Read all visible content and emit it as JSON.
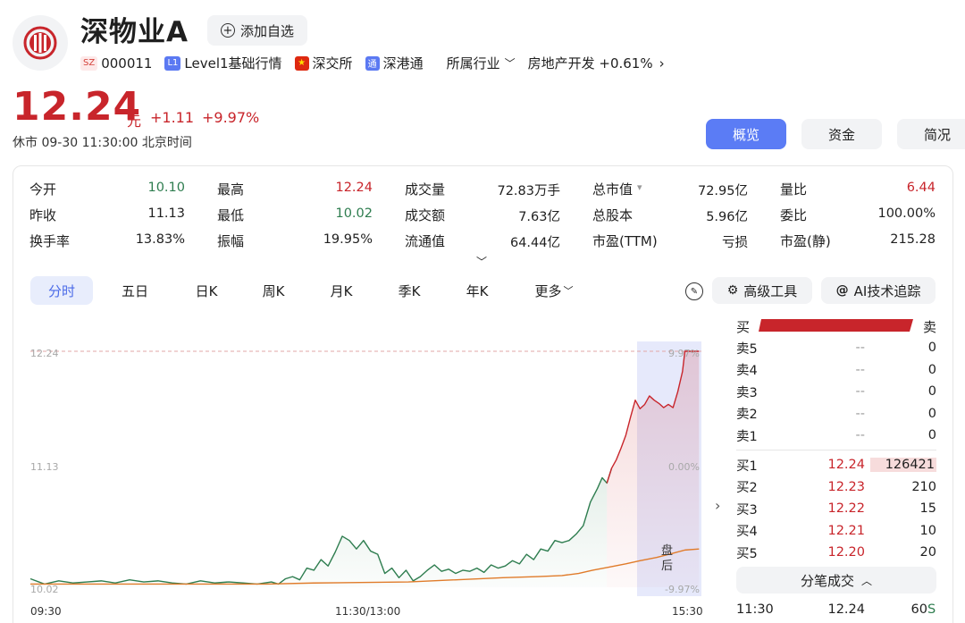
{
  "header": {
    "name": "深物业A",
    "add_favorite": "添加自选",
    "market_tag": "SZ",
    "code": "000011",
    "level_tag": "L1",
    "level_label": "Level1基础行情",
    "exchange": "深交所",
    "connect_tag": "通",
    "connect": "深港通",
    "industry_dropdown": "所属行业",
    "industry": "房地产开发 +0.61%"
  },
  "quote": {
    "price": "12.24",
    "unit": "元",
    "change": "+1.11",
    "change_pct": "+9.97%",
    "status": "休市  09-30 11:30:00 北京时间"
  },
  "top_tabs": [
    "概览",
    "资金",
    "简况"
  ],
  "stats": [
    [
      {
        "label": "今开",
        "value": "10.10",
        "color": "green"
      },
      {
        "label": "最高",
        "value": "12.24",
        "color": "red"
      },
      {
        "label": "成交量",
        "value": "72.83万手",
        "color": ""
      },
      {
        "label": "总市值",
        "value": "72.95亿",
        "color": "",
        "dropdown": "▾"
      },
      {
        "label": "量比",
        "value": "6.44",
        "color": "red"
      }
    ],
    [
      {
        "label": "昨收",
        "value": "11.13",
        "color": ""
      },
      {
        "label": "最低",
        "value": "10.02",
        "color": "green"
      },
      {
        "label": "成交额",
        "value": "7.63亿",
        "color": ""
      },
      {
        "label": "总股本",
        "value": "5.96亿",
        "color": ""
      },
      {
        "label": "委比",
        "value": "100.00%",
        "color": ""
      }
    ],
    [
      {
        "label": "换手率",
        "value": "13.83%",
        "color": ""
      },
      {
        "label": "振幅",
        "value": "19.95%",
        "color": ""
      },
      {
        "label": "流通值",
        "value": "64.44亿",
        "color": ""
      },
      {
        "label": "市盈(TTM)",
        "value": "亏损",
        "color": ""
      },
      {
        "label": "市盈(静)",
        "value": "215.28",
        "color": ""
      }
    ]
  ],
  "chart_tabs": [
    "分时",
    "五日",
    "日K",
    "周K",
    "月K",
    "季K",
    "年K",
    "更多"
  ],
  "tools": {
    "advanced": "高级工具",
    "ai": "AI技术追踪"
  },
  "colors": {
    "up": "#c8252b",
    "down": "#2e7d4f",
    "accent": "#5b7cf5",
    "avg_line": "#e07b2a"
  },
  "chart_data": {
    "type": "line",
    "title": "",
    "y_labels": [
      "12.24",
      "11.13",
      "10.02"
    ],
    "pct_labels": [
      "9.97%",
      "0.00%",
      "-9.97%"
    ],
    "x_labels": [
      "09:30",
      "11:30/13:00",
      "15:30"
    ],
    "after_hours_label": "盘后",
    "ylim": [
      10.02,
      12.24
    ],
    "prev_close": 11.13,
    "series": [
      {
        "name": "",
        "points": [
          [
            0,
            10.1
          ],
          [
            6,
            10.05
          ],
          [
            12,
            10.08
          ],
          [
            18,
            10.06
          ],
          [
            24,
            10.07
          ],
          [
            30,
            10.08
          ],
          [
            36,
            10.06
          ],
          [
            42,
            10.09
          ],
          [
            48,
            10.07
          ],
          [
            54,
            10.08
          ],
          [
            60,
            10.06
          ],
          [
            66,
            10.05
          ],
          [
            72,
            10.08
          ],
          [
            78,
            10.06
          ],
          [
            84,
            10.07
          ],
          [
            90,
            10.06
          ],
          [
            96,
            10.05
          ],
          [
            102,
            10.07
          ],
          [
            105,
            10.05
          ],
          [
            108,
            10.1
          ],
          [
            111,
            10.12
          ],
          [
            114,
            10.09
          ],
          [
            117,
            10.2
          ],
          [
            120,
            10.18
          ],
          [
            123,
            10.28
          ],
          [
            126,
            10.22
          ],
          [
            129,
            10.35
          ],
          [
            132,
            10.5
          ],
          [
            135,
            10.46
          ],
          [
            138,
            10.38
          ],
          [
            141,
            10.46
          ],
          [
            144,
            10.36
          ],
          [
            147,
            10.33
          ],
          [
            150,
            10.15
          ],
          [
            153,
            10.2
          ],
          [
            156,
            10.11
          ],
          [
            159,
            10.18
          ],
          [
            162,
            10.08
          ],
          [
            165,
            10.12
          ],
          [
            168,
            10.18
          ],
          [
            171,
            10.23
          ],
          [
            174,
            10.17
          ],
          [
            177,
            10.19
          ],
          [
            180,
            10.15
          ],
          [
            183,
            10.18
          ],
          [
            186,
            10.17
          ],
          [
            189,
            10.2
          ],
          [
            192,
            10.16
          ],
          [
            195,
            10.23
          ],
          [
            198,
            10.2
          ],
          [
            201,
            10.22
          ],
          [
            204,
            10.27
          ],
          [
            207,
            10.24
          ],
          [
            210,
            10.33
          ],
          [
            213,
            10.28
          ],
          [
            216,
            10.38
          ],
          [
            219,
            10.36
          ],
          [
            222,
            10.46
          ],
          [
            225,
            10.44
          ],
          [
            228,
            10.46
          ],
          [
            231,
            10.52
          ],
          [
            234,
            10.6
          ],
          [
            237,
            10.82
          ],
          [
            240,
            10.95
          ],
          [
            242,
            11.05
          ],
          [
            244,
            11.0
          ],
          [
            246,
            11.14
          ],
          [
            248,
            11.22
          ],
          [
            250,
            11.33
          ],
          [
            252,
            11.45
          ],
          [
            254,
            11.62
          ],
          [
            256,
            11.78
          ],
          [
            258,
            11.7
          ],
          [
            260,
            11.74
          ],
          [
            262,
            11.82
          ],
          [
            264,
            11.78
          ],
          [
            266,
            11.75
          ],
          [
            268,
            11.71
          ],
          [
            270,
            11.74
          ],
          [
            272,
            11.71
          ],
          [
            274,
            11.86
          ],
          [
            276,
            12.05
          ],
          [
            277,
            12.24
          ],
          [
            280,
            12.24
          ],
          [
            283,
            12.24
          ]
        ]
      },
      {
        "name": "",
        "points": [
          [
            0,
            10.05
          ],
          [
            60,
            10.05
          ],
          [
            100,
            10.05
          ],
          [
            120,
            10.06
          ],
          [
            160,
            10.07
          ],
          [
            200,
            10.11
          ],
          [
            215,
            10.12
          ],
          [
            225,
            10.13
          ],
          [
            232,
            10.15
          ],
          [
            238,
            10.18
          ],
          [
            245,
            10.21
          ],
          [
            252,
            10.24
          ],
          [
            258,
            10.27
          ],
          [
            265,
            10.3
          ],
          [
            272,
            10.34
          ],
          [
            277,
            10.37
          ],
          [
            283,
            10.38
          ]
        ]
      }
    ],
    "grid": false
  },
  "order_book": {
    "buy_label": "买",
    "sell_label": "卖",
    "sells": [
      {
        "label": "卖5",
        "price": "--",
        "volume": "0"
      },
      {
        "label": "卖4",
        "price": "--",
        "volume": "0"
      },
      {
        "label": "卖3",
        "price": "--",
        "volume": "0"
      },
      {
        "label": "卖2",
        "price": "--",
        "volume": "0"
      },
      {
        "label": "卖1",
        "price": "--",
        "volume": "0"
      }
    ],
    "buys": [
      {
        "label": "买1",
        "price": "12.24",
        "volume": "126421"
      },
      {
        "label": "买2",
        "price": "12.23",
        "volume": "210"
      },
      {
        "label": "买3",
        "price": "12.22",
        "volume": "15"
      },
      {
        "label": "买4",
        "price": "12.21",
        "volume": "10"
      },
      {
        "label": "买5",
        "price": "12.20",
        "volume": "20"
      }
    ],
    "trades_toggle": "分笔成交",
    "trades": [
      {
        "time": "11:30",
        "price": "12.24",
        "volume": "60",
        "flag": "S"
      }
    ]
  }
}
